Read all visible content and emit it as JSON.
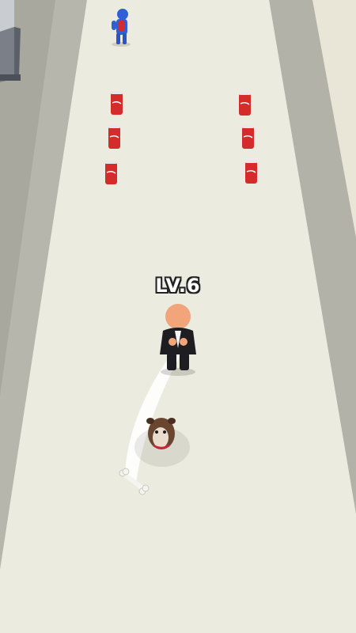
{
  "player": {
    "level_label": "LV.6"
  },
  "colors": {
    "ground": "#e9e6d8",
    "road": "#ecebdf",
    "road_edge": "#a5a59c",
    "can_red": "#d32c2a",
    "enemy_blue": "#2f5fd6",
    "suit": "#1e1e22",
    "skin": "#f2a57b"
  },
  "items": {
    "cans_left_count": 3,
    "cans_right_count": 3,
    "bone_count": 1,
    "enemy_count": 1,
    "dog_count": 1
  }
}
